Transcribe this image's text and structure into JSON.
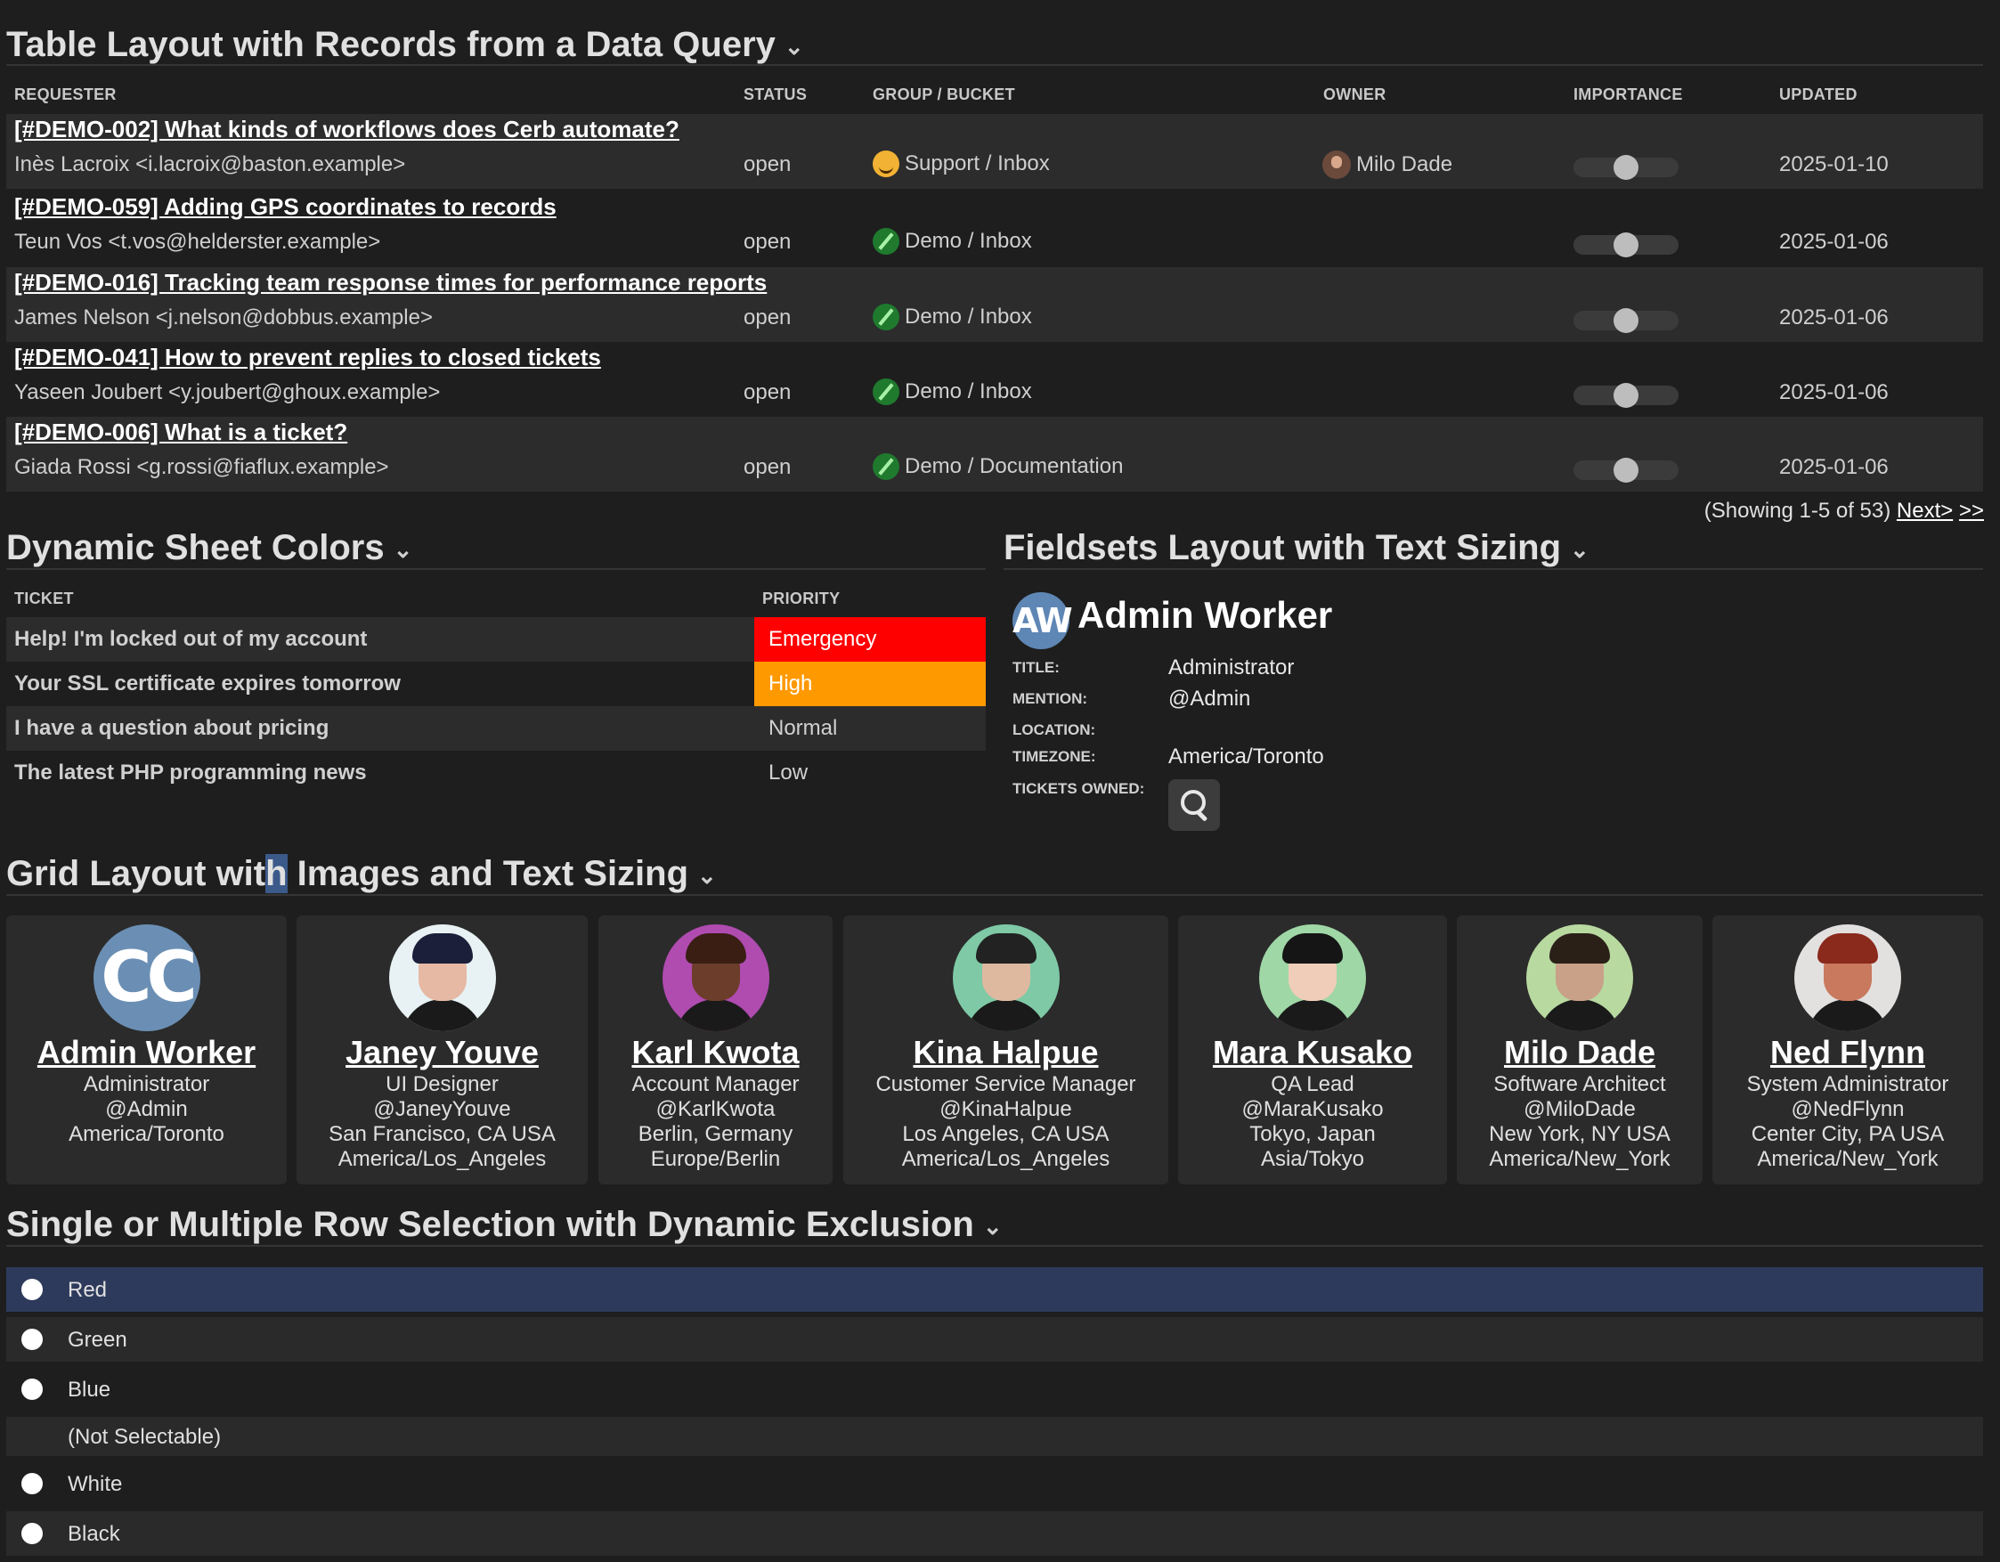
{
  "section1": {
    "title": "Table Layout with Records from a Data Query",
    "headers": [
      "Requester",
      "Status",
      "Group / Bucket",
      "Owner",
      "Importance",
      "Updated"
    ],
    "rows": [
      {
        "subject": "[#DEMO-002] What kinds of workflows does Cerb automate?",
        "requester": "Inès Lacroix <i.lacroix@baston.example>",
        "status": "open",
        "group": "Support / Inbox",
        "group_icon": "smile-icon",
        "owner": "Milo Dade",
        "importance": 0.5,
        "updated": "2025-01-10"
      },
      {
        "subject": "[#DEMO-059] Adding GPS coordinates to records",
        "requester": "Teun Vos <t.vos@helderster.example>",
        "status": "open",
        "group": "Demo / Inbox",
        "group_icon": "leaf-icon",
        "owner": "",
        "importance": 0.5,
        "updated": "2025-01-06"
      },
      {
        "subject": "[#DEMO-016] Tracking team response times for performance reports",
        "requester": "James Nelson <j.nelson@dobbus.example>",
        "status": "open",
        "group": "Demo / Inbox",
        "group_icon": "leaf-icon",
        "owner": "",
        "importance": 0.5,
        "updated": "2025-01-06"
      },
      {
        "subject": "[#DEMO-041] How to prevent replies to closed tickets",
        "requester": "Yaseen Joubert <y.joubert@ghoux.example>",
        "status": "open",
        "group": "Demo / Inbox",
        "group_icon": "leaf-icon",
        "owner": "",
        "importance": 0.5,
        "updated": "2025-01-06"
      },
      {
        "subject": "[#DEMO-006] What is a ticket?",
        "requester": "Giada Rossi <g.rossi@fiaflux.example>",
        "status": "open",
        "group": "Demo / Documentation",
        "group_icon": "leaf-icon",
        "owner": "",
        "importance": 0.5,
        "updated": "2025-01-06"
      }
    ],
    "pager": {
      "text": "(Showing 1-5 of 53)",
      "next": "Next>",
      "last": ">>"
    }
  },
  "section2": {
    "title": "Dynamic Sheet Colors",
    "headers": [
      "Ticket",
      "Priority"
    ],
    "rows": [
      {
        "ticket": "Help! I'm locked out of my account",
        "priority": "Emergency",
        "bg": "#ff0000",
        "fg": "#ffffff"
      },
      {
        "ticket": "Your SSL certificate expires tomorrow",
        "priority": "High",
        "bg": "#ff9900",
        "fg": "#ffffff"
      },
      {
        "ticket": "I have a question about pricing",
        "priority": "Normal",
        "bg": "",
        "fg": "#d0d0d0"
      },
      {
        "ticket": "The latest PHP programming news",
        "priority": "Low",
        "bg": "",
        "fg": "#d0d0d0"
      }
    ]
  },
  "section3": {
    "title": "Fieldsets Layout with Text Sizing",
    "avatar_initials": "AW",
    "name": "Admin Worker",
    "fields": [
      {
        "label": "Title:",
        "value": "Administrator"
      },
      {
        "label": "Mention:",
        "value": "@Admin"
      },
      {
        "label": "Location:",
        "value": ""
      },
      {
        "label": "Timezone:",
        "value": "America/Toronto"
      },
      {
        "label": "Tickets Owned:",
        "value": ""
      }
    ]
  },
  "section4": {
    "title_pre": "Grid Layout wit",
    "title_hl": "h",
    "title_post": " Images and Text Sizing",
    "cards": [
      {
        "name": "Admin Worker",
        "initials": "CC",
        "lines": [
          "Administrator",
          "@Admin",
          "America/Toronto"
        ]
      },
      {
        "name": "Janey Youve",
        "lines": [
          "UI Designer",
          "@JaneyYouve",
          "San Francisco, CA USA",
          "America/Los_Angeles"
        ],
        "colors": {
          "bg": "#e8f2f4",
          "face": "#e5b9a3",
          "hair": "#1b1f3a"
        }
      },
      {
        "name": "Karl Kwota",
        "lines": [
          "Account Manager",
          "@KarlKwota",
          "Berlin, Germany",
          "Europe/Berlin"
        ],
        "colors": {
          "bg": "#b04bb0",
          "face": "#6b3d2a",
          "hair": "#3a1e14"
        }
      },
      {
        "name": "Kina Halpue",
        "lines": [
          "Customer Service Manager",
          "@KinaHalpue",
          "Los Angeles, CA USA",
          "America/Los_Angeles"
        ],
        "colors": {
          "bg": "#7fc9a6",
          "face": "#dfb8a0",
          "hair": "#222222"
        }
      },
      {
        "name": "Mara Kusako",
        "lines": [
          "QA Lead",
          "@MaraKusako",
          "Tokyo, Japan",
          "Asia/Tokyo"
        ],
        "colors": {
          "bg": "#9fd7a6",
          "face": "#f0cdb8",
          "hair": "#151515"
        }
      },
      {
        "name": "Milo Dade",
        "lines": [
          "Software Architect",
          "@MiloDade",
          "New York, NY USA",
          "America/New_York"
        ],
        "colors": {
          "bg": "#b8d9a0",
          "face": "#c9a088",
          "hair": "#2a2018"
        }
      },
      {
        "name": "Ned Flynn",
        "lines": [
          "System Administrator",
          "@NedFlynn",
          "Center City, PA USA",
          "America/New_York"
        ],
        "colors": {
          "bg": "#e3e0e0",
          "face": "#c9795e",
          "hair": "#8a2a1c"
        }
      }
    ]
  },
  "section5": {
    "title": "Single or Multiple Row Selection with Dynamic Exclusion",
    "rows": [
      {
        "label": "Red",
        "selectable": true,
        "selected": true
      },
      {
        "label": "Green",
        "selectable": true,
        "selected": false
      },
      {
        "label": "Blue",
        "selectable": true,
        "selected": false
      },
      {
        "label": "(Not Selectable)",
        "selectable": false,
        "selected": false
      },
      {
        "label": "White",
        "selectable": true,
        "selected": false
      },
      {
        "label": "Black",
        "selectable": true,
        "selected": false
      }
    ]
  },
  "icons": {
    "chevron": "chevron-down-icon",
    "search": "search-icon",
    "radio": "radio-icon"
  }
}
